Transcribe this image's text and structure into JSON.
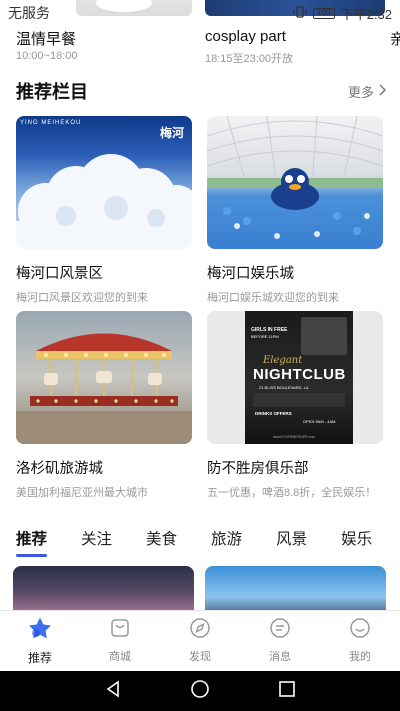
{
  "status_bar": {
    "carrier": "无服务",
    "battery": "100",
    "time": "下午2:32"
  },
  "top_strip": {
    "items": [
      {
        "title": "温情早餐",
        "subtitle": "10:00~18:00"
      },
      {
        "title": "cosplay part",
        "subtitle": "18:15至23:00开放"
      },
      {
        "title": "亲",
        "subtitle": ""
      }
    ]
  },
  "section": {
    "title": "推荐栏目",
    "more_label": "更多"
  },
  "cards": [
    {
      "title": "梅河口风景区",
      "desc": "梅河口风景区欢迎您的到来",
      "image": "snowy-trees-photo",
      "image_text_1": "YING MEIHEKOU",
      "image_text_2": "梅河"
    },
    {
      "title": "梅河口娱乐城",
      "desc": "梅河口娱乐城欢迎您的到来",
      "image": "ball-pit-playground-photo"
    },
    {
      "title": "洛杉矶旅游城",
      "desc": "美国加利福尼亚州最大城市",
      "image": "carousel-photo"
    },
    {
      "title": "防不胜房俱乐部",
      "desc": "五一优惠，啤酒8.8折，全民娱乐！",
      "image": "nightclub-flyer",
      "poster": {
        "line1": "GIRLS IN FREE",
        "line2": "BEFORE 11PM",
        "script": "Elegant",
        "headline": "NIGHTCLUB",
        "address": "21 BLISS BOULEVARD, LA",
        "drinks": "DRINKS OFFERS",
        "open": "OPEN 9AM - 4AM",
        "site": "www.FLYERMERGER.com"
      }
    }
  ],
  "tabs": [
    "推荐",
    "关注",
    "美食",
    "旅游",
    "风景",
    "娱乐"
  ],
  "active_tab": "推荐",
  "bottom_nav": [
    {
      "label": "推荐",
      "icon": "star-icon",
      "active": true
    },
    {
      "label": "商城",
      "icon": "shopping-bag-icon",
      "active": false
    },
    {
      "label": "发现",
      "icon": "compass-icon",
      "active": false
    },
    {
      "label": "消息",
      "icon": "message-icon",
      "active": false
    },
    {
      "label": "我的",
      "icon": "profile-icon",
      "active": false
    }
  ],
  "colors": {
    "accent": "#3b5bdb",
    "text_primary": "#111111",
    "text_secondary": "#999999",
    "active_icon": "#3d6df2"
  }
}
